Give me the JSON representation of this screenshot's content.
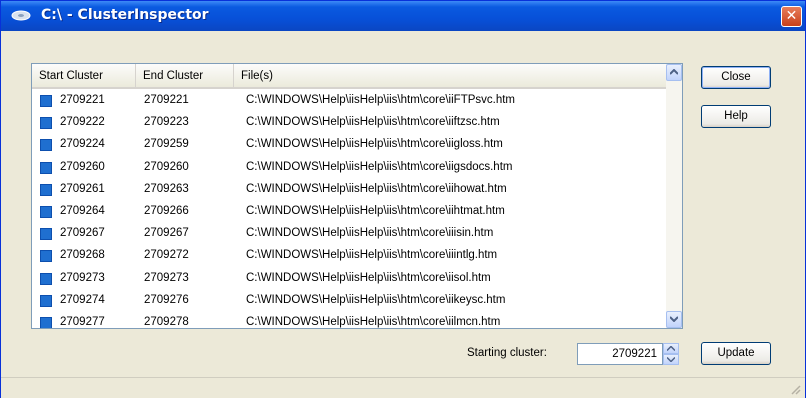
{
  "window": {
    "title": "C:\\ - ClusterInspector",
    "close_glyph": "✕"
  },
  "list": {
    "headers": [
      "Start Cluster",
      "End Cluster",
      "File(s)"
    ],
    "rows": [
      {
        "start": "2709221",
        "end": "2709221",
        "file": "C:\\WINDOWS\\Help\\iisHelp\\iis\\htm\\core\\iiFTPsvc.htm"
      },
      {
        "start": "2709222",
        "end": "2709223",
        "file": "C:\\WINDOWS\\Help\\iisHelp\\iis\\htm\\core\\iiftzsc.htm"
      },
      {
        "start": "2709224",
        "end": "2709259",
        "file": "C:\\WINDOWS\\Help\\iisHelp\\iis\\htm\\core\\iigloss.htm"
      },
      {
        "start": "2709260",
        "end": "2709260",
        "file": "C:\\WINDOWS\\Help\\iisHelp\\iis\\htm\\core\\iigsdocs.htm"
      },
      {
        "start": "2709261",
        "end": "2709263",
        "file": "C:\\WINDOWS\\Help\\iisHelp\\iis\\htm\\core\\iihowat.htm"
      },
      {
        "start": "2709264",
        "end": "2709266",
        "file": "C:\\WINDOWS\\Help\\iisHelp\\iis\\htm\\core\\iihtmat.htm"
      },
      {
        "start": "2709267",
        "end": "2709267",
        "file": "C:\\WINDOWS\\Help\\iisHelp\\iis\\htm\\core\\iiisin.htm"
      },
      {
        "start": "2709268",
        "end": "2709272",
        "file": "C:\\WINDOWS\\Help\\iisHelp\\iis\\htm\\core\\iiintlg.htm"
      },
      {
        "start": "2709273",
        "end": "2709273",
        "file": "C:\\WINDOWS\\Help\\iisHelp\\iis\\htm\\core\\iisol.htm"
      },
      {
        "start": "2709274",
        "end": "2709276",
        "file": "C:\\WINDOWS\\Help\\iisHelp\\iis\\htm\\core\\iikeysc.htm"
      },
      {
        "start": "2709277",
        "end": "2709278",
        "file": "C:\\WINDOWS\\Help\\iisHelp\\iis\\htm\\core\\iilmcn.htm"
      }
    ]
  },
  "buttons": {
    "close": "Close",
    "help": "Help",
    "update": "Update"
  },
  "starting_cluster": {
    "label": "Starting cluster:",
    "value": "2709221"
  },
  "icons": {
    "title": "drive-icon",
    "row": "cluster-square-icon",
    "scroll_up": "scroll-up-arrow-icon",
    "scroll_down": "scroll-down-arrow-icon"
  },
  "colors": {
    "titlebar": "#0a5ae0",
    "row_marker": "#1f6fd0",
    "close_button": "#c9401a"
  }
}
